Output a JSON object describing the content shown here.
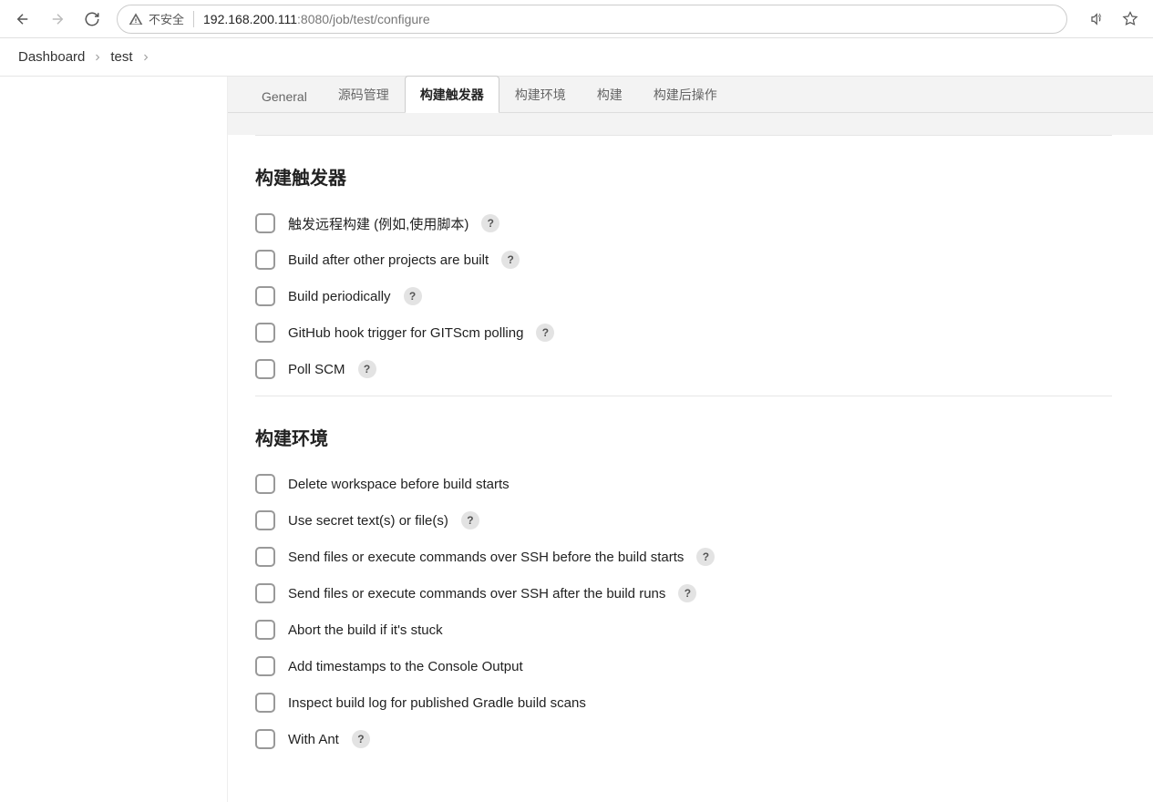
{
  "browser": {
    "insecure_label": "不安全",
    "url_host": "192.168.200.111",
    "url_port": ":8080",
    "url_path": "/job/test/configure"
  },
  "breadcrumb": {
    "items": [
      "Dashboard",
      "test"
    ]
  },
  "tabs": [
    {
      "label": "General"
    },
    {
      "label": "源码管理"
    },
    {
      "label": "构建触发器"
    },
    {
      "label": "构建环境"
    },
    {
      "label": "构建"
    },
    {
      "label": "构建后操作"
    }
  ],
  "sections": {
    "triggers": {
      "title": "构建触发器",
      "options": [
        {
          "label": "触发远程构建 (例如,使用脚本)",
          "help": true
        },
        {
          "label": "Build after other projects are built",
          "help": true
        },
        {
          "label": "Build periodically",
          "help": true
        },
        {
          "label": "GitHub hook trigger for GITScm polling",
          "help": true
        },
        {
          "label": "Poll SCM",
          "help": true
        }
      ]
    },
    "env": {
      "title": "构建环境",
      "options": [
        {
          "label": "Delete workspace before build starts",
          "help": false
        },
        {
          "label": "Use secret text(s) or file(s)",
          "help": true
        },
        {
          "label": "Send files or execute commands over SSH before the build starts",
          "help": true
        },
        {
          "label": "Send files or execute commands over SSH after the build runs",
          "help": true
        },
        {
          "label": "Abort the build if it's stuck",
          "help": false
        },
        {
          "label": "Add timestamps to the Console Output",
          "help": false
        },
        {
          "label": "Inspect build log for published Gradle build scans",
          "help": false
        },
        {
          "label": "With Ant",
          "help": true
        }
      ]
    }
  },
  "help_glyph": "?"
}
